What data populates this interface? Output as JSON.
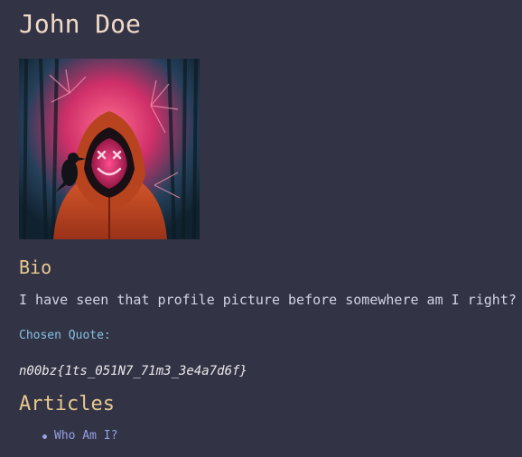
{
  "profile": {
    "name": "John Doe"
  },
  "bio": {
    "heading": "Bio",
    "text": "I have seen that profile picture before somewhere am I right?"
  },
  "quote": {
    "label": "Chosen Quote:",
    "text": "n00bz{1ts_051N7_71m3_3e4a7d6f}"
  },
  "articles": {
    "heading": "Articles",
    "items": [
      {
        "label": "Who Am I?"
      }
    ]
  },
  "colors": {
    "background": "#323446",
    "name": "#f0d9c7",
    "heading": "#e9c88f",
    "quote_label": "#86c0df",
    "link": "#969ee0"
  },
  "icons": {
    "avatar": "hooded-figure-neon-mask-avatar"
  }
}
